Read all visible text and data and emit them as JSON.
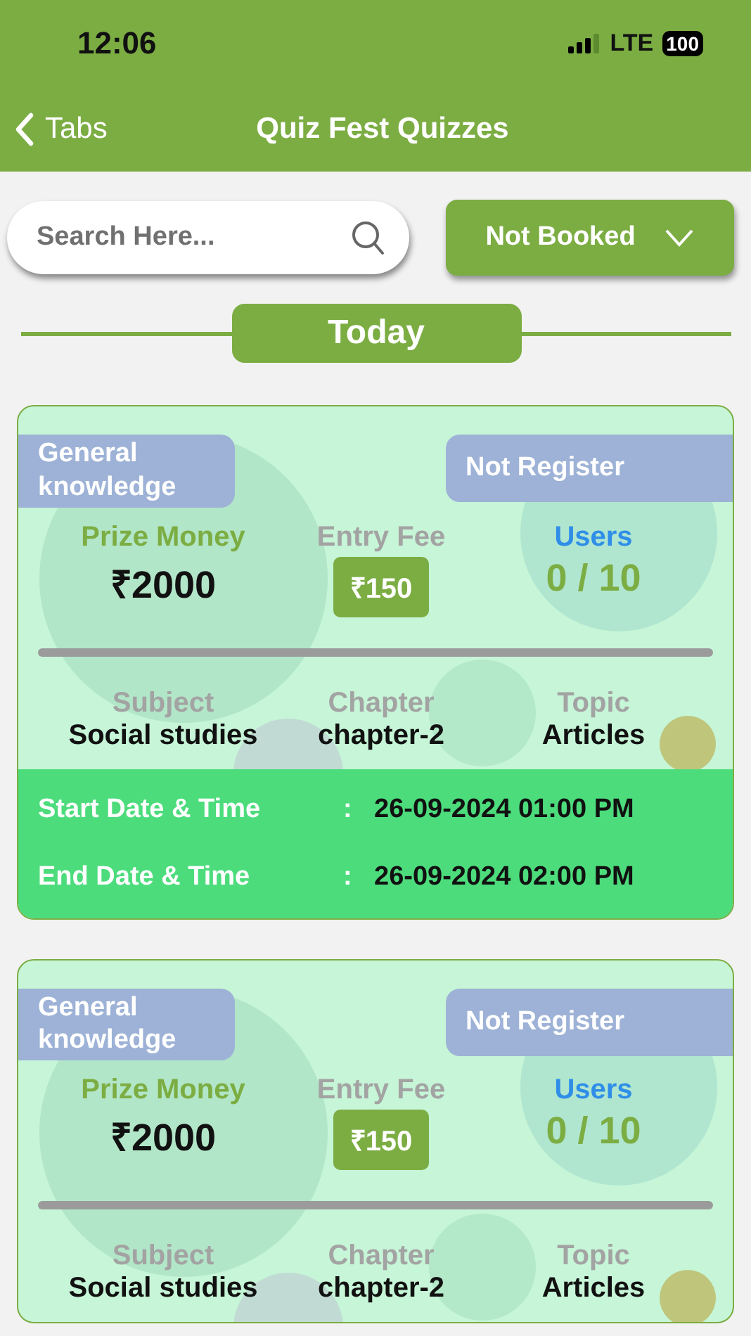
{
  "status_bar": {
    "time": "12:06",
    "network": "LTE",
    "battery": "100"
  },
  "nav": {
    "back": "Tabs",
    "title": "Quiz Fest Quizzes"
  },
  "search": {
    "placeholder": "Search Here..."
  },
  "filter": {
    "label": "Not Booked"
  },
  "section": "Today",
  "quizzes": [
    {
      "category": "General knowledge",
      "status": "Not Register",
      "prize_label": "Prize Money",
      "prize": "₹2000",
      "fee_label": "Entry Fee",
      "fee": "₹150",
      "users_label": "Users",
      "users": "0 / 10",
      "subject_label": "Subject",
      "subject": "Social studies",
      "chapter_label": "Chapter",
      "chapter": "chapter-2",
      "topic_label": "Topic",
      "topic": "Articles",
      "dates": [
        {
          "label": "Start Date & Time",
          "sep": ":",
          "value": "26-09-2024 01:00 PM"
        },
        {
          "label": "End Date & Time",
          "sep": ":",
          "value": "26-09-2024 02:00 PM"
        }
      ]
    },
    {
      "category": "General knowledge",
      "status": "Not Register",
      "prize_label": "Prize Money",
      "prize": "₹2000",
      "fee_label": "Entry Fee",
      "fee": "₹150",
      "users_label": "Users",
      "users": "0 / 10",
      "subject_label": "Subject",
      "subject": "Social studies",
      "chapter_label": "Chapter",
      "chapter": "chapter-2",
      "topic_label": "Topic",
      "topic": "Articles"
    }
  ]
}
